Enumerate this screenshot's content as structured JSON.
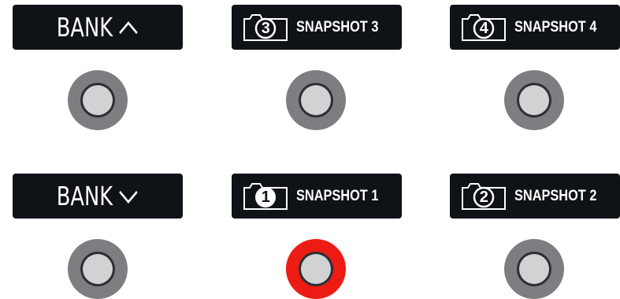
{
  "switches": [
    {
      "label": "BANK",
      "arrow": "chevron-up-icon"
    },
    {
      "label": "SNAPSHOT 3",
      "number": "3",
      "icon": "camera-icon",
      "active": false
    },
    {
      "label": "SNAPSHOT 4",
      "number": "4",
      "icon": "camera-icon",
      "active": false
    },
    {
      "label": "BANK",
      "arrow": "chevron-down-icon"
    },
    {
      "label": "SNAPSHOT 1",
      "number": "1",
      "icon": "camera-icon",
      "active": true
    },
    {
      "label": "SNAPSHOT 2",
      "number": "2",
      "icon": "camera-icon",
      "active": false
    }
  ],
  "colors": {
    "display_bg": "#0f1318",
    "display_text": "#ffffff",
    "footswitch_ring": "#7c7e82",
    "footswitch_active_ring": "#ec1c14",
    "footswitch_cap": "#d1d2d4"
  }
}
